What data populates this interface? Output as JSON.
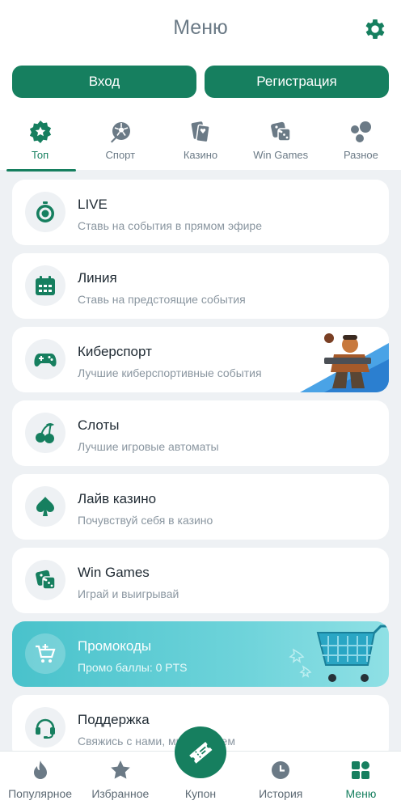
{
  "header": {
    "title": "Меню"
  },
  "auth": {
    "login": "Вход",
    "register": "Регистрация"
  },
  "categories": [
    {
      "label": "Топ",
      "icon": "star-badge-icon",
      "active": true
    },
    {
      "label": "Спорт",
      "icon": "soccer-ball-icon"
    },
    {
      "label": "Казино",
      "icon": "playing-cards-icon"
    },
    {
      "label": "Win Games",
      "icon": "dice-icon"
    },
    {
      "label": "Разное",
      "icon": "bubbles-icon"
    }
  ],
  "menu": [
    {
      "title": "LIVE",
      "subtitle": "Ставь на события в прямом эфире",
      "icon": "stopwatch-icon"
    },
    {
      "title": "Линия",
      "subtitle": "Ставь на предстоящие события",
      "icon": "calendar-icon"
    },
    {
      "title": "Киберспорт",
      "subtitle": "Лучшие киберспортивные события",
      "icon": "gamepad-icon"
    },
    {
      "title": "Слоты",
      "subtitle": "Лучшие игровые автоматы",
      "icon": "cherries-icon"
    },
    {
      "title": "Лайв казино",
      "subtitle": "Почувствуй себя в казино",
      "icon": "spade-icon"
    },
    {
      "title": "Win Games",
      "subtitle": "Играй и выигрывай",
      "icon": "dice-icon"
    },
    {
      "title": "Промокоды",
      "subtitle": "Промо баллы: 0 PTS",
      "icon": "cart-icon"
    },
    {
      "title": "Поддержка",
      "subtitle": "Свяжись с нами, мы поможем",
      "icon": "headset-icon"
    }
  ],
  "bottom_nav": [
    {
      "label": "Популярное",
      "icon": "flame-icon"
    },
    {
      "label": "Избранное",
      "icon": "star-icon"
    },
    {
      "label": "Купон",
      "icon": "ticket-icon"
    },
    {
      "label": "История",
      "icon": "clock-icon"
    },
    {
      "label": "Меню",
      "icon": "grid-icon",
      "active": true
    }
  ],
  "colors": {
    "accent": "#167f5f",
    "background": "#eef1f4",
    "promo": "#49c2cb",
    "muted": "#6b7a86"
  }
}
